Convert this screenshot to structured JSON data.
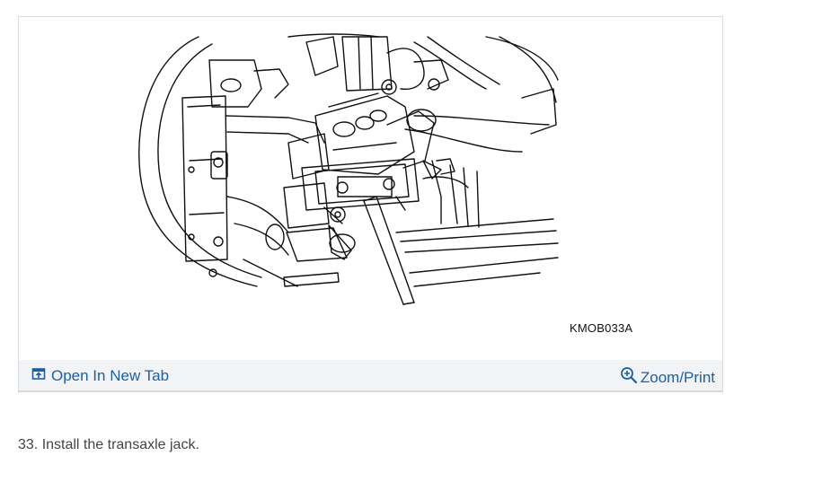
{
  "figure": {
    "code": "KMOB033A",
    "open_tab_label": "Open In New Tab",
    "zoom_label": "Zoom/Print",
    "open_icon": "open-new-tab-icon",
    "zoom_icon": "zoom-in-icon",
    "link_color": "#1b5fa8",
    "toolbar_color": "#f2f3f5"
  },
  "step": {
    "text": "33. Install the transaxle jack."
  }
}
